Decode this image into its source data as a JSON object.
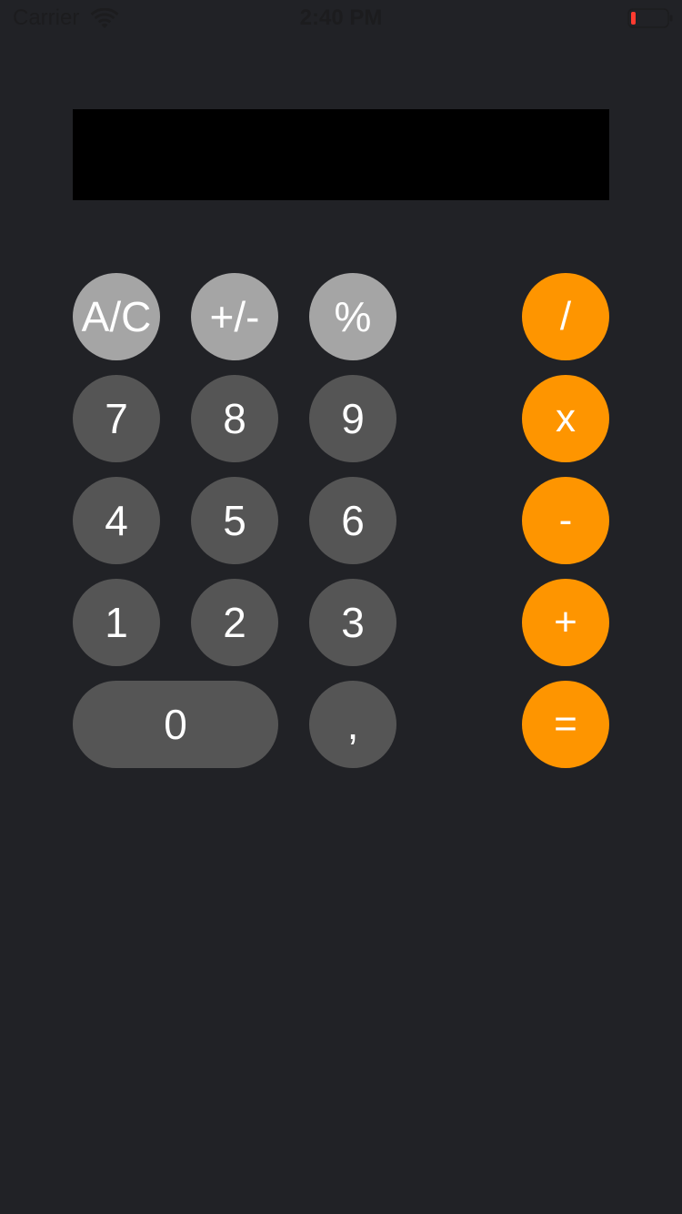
{
  "status_bar": {
    "carrier": "Carrier",
    "time": "2:40 PM",
    "wifi_icon": "wifi-icon",
    "battery_icon": "battery-icon",
    "battery_level_fraction": 0.08,
    "battery_color": "#ff3b30"
  },
  "display": {
    "value": ""
  },
  "keypad": {
    "function_keys": [
      {
        "label": "A/C"
      },
      {
        "label": "+/-"
      },
      {
        "label": "%"
      }
    ],
    "digit_keys": [
      {
        "label": "7"
      },
      {
        "label": "8"
      },
      {
        "label": "9"
      },
      {
        "label": "4"
      },
      {
        "label": "5"
      },
      {
        "label": "6"
      },
      {
        "label": "1"
      },
      {
        "label": "2"
      },
      {
        "label": "3"
      },
      {
        "label": "0"
      },
      {
        "label": ","
      }
    ],
    "operator_keys": [
      {
        "label": "/"
      },
      {
        "label": "x"
      },
      {
        "label": "-"
      },
      {
        "label": "+"
      },
      {
        "label": "="
      }
    ]
  },
  "colors": {
    "background": "#212226",
    "display_background": "#000000",
    "function_key": "#a5a5a5",
    "digit_key": "#555555",
    "operator_key": "#fe9500",
    "key_text": "#ffffff"
  }
}
